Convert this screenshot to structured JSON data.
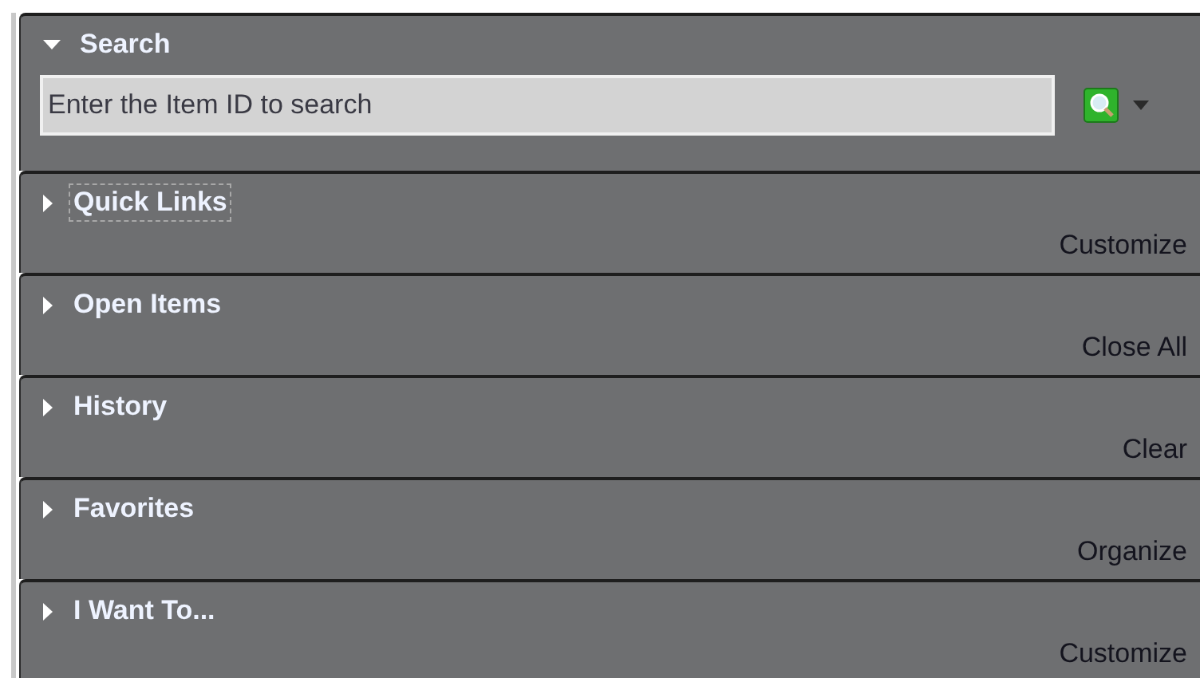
{
  "search": {
    "title": "Search",
    "expanded": true,
    "placeholder": "Enter the Item ID to search"
  },
  "sections": [
    {
      "title": "Quick Links",
      "expanded": false,
      "focused": true,
      "action": "Customize"
    },
    {
      "title": "Open Items",
      "expanded": false,
      "focused": false,
      "action": "Close All"
    },
    {
      "title": "History",
      "expanded": false,
      "focused": false,
      "action": "Clear"
    },
    {
      "title": "Favorites",
      "expanded": false,
      "focused": false,
      "action": "Organize"
    },
    {
      "title": "I Want To...",
      "expanded": false,
      "focused": false,
      "action": "Customize"
    }
  ]
}
